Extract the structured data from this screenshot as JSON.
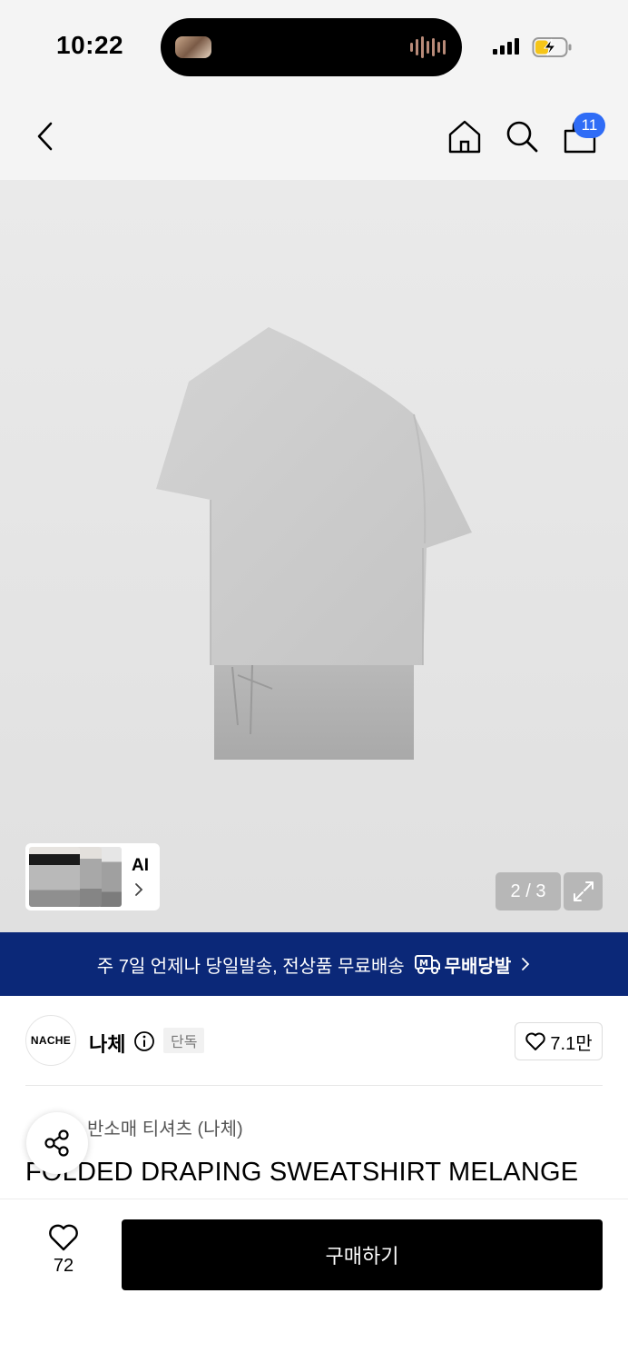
{
  "status_bar": {
    "time": "10:22"
  },
  "nav": {
    "cart_count": "11"
  },
  "gallery": {
    "ai_label": "AI",
    "page_indicator": "2 / 3"
  },
  "shipping_banner": {
    "text": "주 7일 언제나 당일발송, 전상품 무료배송",
    "logo_text": "무배당발"
  },
  "brand": {
    "logo_text": "NACHE",
    "name": "나체",
    "badge": "단독",
    "like_count": "7.1만"
  },
  "product": {
    "category": "반소매 티셔츠 (나체)",
    "title": "FOLDED DRAPING SWEATSHIRT MELANGE"
  },
  "bottom_bar": {
    "like_count": "72",
    "buy_label": "구매하기"
  },
  "colors": {
    "banner_bg": "#0b2878",
    "badge_blue": "#2f6cf6",
    "buy_bg": "#000000"
  }
}
